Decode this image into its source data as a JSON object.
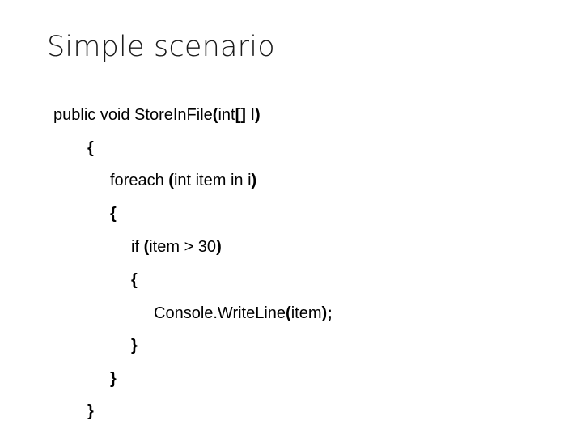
{
  "slide": {
    "title": "Simple scenario"
  },
  "code": {
    "line1": {
      "a": "public void StoreInFile",
      "b": "(",
      "c": "int",
      "d": "[]",
      "e": " I",
      "f": ")"
    },
    "line2": {
      "a": "{"
    },
    "line3": {
      "a": "foreach ",
      "b": "(",
      "c": "int item in i",
      "d": ")"
    },
    "line4": {
      "a": "{"
    },
    "line5": {
      "a": "if ",
      "b": "(",
      "c": "item > 30",
      "d": ")"
    },
    "line6": {
      "a": "{"
    },
    "line7": {
      "a": "Console.WriteLine",
      "b": "(",
      "c": "item",
      "d": ");"
    },
    "line8": {
      "a": "}"
    },
    "line9": {
      "a": "}"
    },
    "line10": {
      "a": "}"
    }
  }
}
